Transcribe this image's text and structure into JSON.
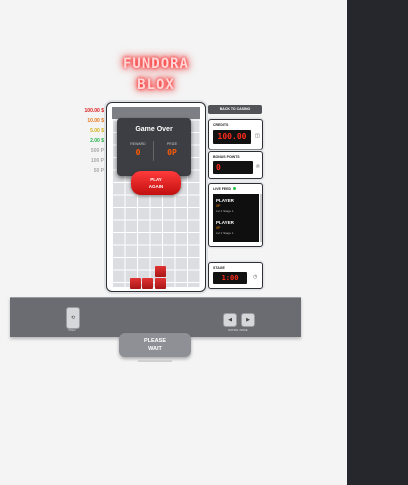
{
  "app": {
    "logo_line1": "FUNDORA",
    "logo_line2": "BLOX"
  },
  "paytable": [
    {
      "label": "100.00 $",
      "color": "#d81b1b"
    },
    {
      "label": "10.00 $",
      "color": "#e8761a"
    },
    {
      "label": "5.00 $",
      "color": "#d6b11a"
    },
    {
      "label": "2.00 $",
      "color": "#26b34a"
    },
    {
      "label": "500 P",
      "color": "#a9a9a9"
    },
    {
      "label": "100 P",
      "color": "#a9a9a9"
    },
    {
      "label": "50 P",
      "color": "#a9a9a9"
    }
  ],
  "game_over": {
    "title": "Game Over",
    "reward_label": "REWARD",
    "reward_value": "0",
    "prize_label": "PRIZE",
    "prize_value": "0P",
    "play_again_line1": "PLAY",
    "play_again_line2": "AGAIN"
  },
  "sidebar": {
    "back_button": "BACK TO CASINO",
    "credits_label": "CREDITS",
    "credits_value": "100.00",
    "bonus_label": "BONUS POINTS",
    "bonus_value": "0",
    "live_feed_label": "LIVE FEED",
    "live_feed": [
      {
        "name": "PLAYER",
        "points": "0P",
        "stage": "Lvl 1 Stage 1"
      },
      {
        "name": "PLAYER",
        "points": "0P",
        "stage": "Lvl 1 Stage 1"
      }
    ],
    "stage_label": "STAGE",
    "stage_value": "1:00"
  },
  "controls": {
    "left_label": "HOLD",
    "right_label": "ROTATE / MOVE",
    "left_button_glyph": "⟲",
    "arrow_left_glyph": "◀",
    "arrow_right_glyph": "▶"
  },
  "status": {
    "please_wait_line1": "PLEASE",
    "please_wait_line2": "WAIT"
  },
  "colors": {
    "accent_red": "#e01010",
    "panel_dark": "#25272d",
    "control_bar": "#6a6c72"
  }
}
